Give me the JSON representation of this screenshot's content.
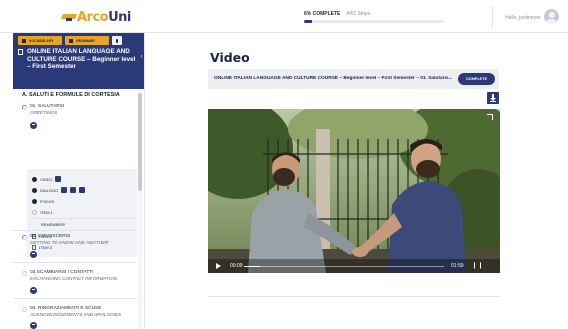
{
  "topbar": {
    "logo_a": "Arco",
    "logo_b": "Uni",
    "progress_text": "6% COMPLETE",
    "steps_text": "4/61 Steps",
    "progress_value": 0.06,
    "greeting": "Hello, jsolmecer"
  },
  "sidebar": {
    "vocabulary_label": "VOCABULARY",
    "grammar_label": "GRAMMAR",
    "course_title": "ONLINE ITALIAN LANGUAGE AND CULTURE COURSE – Beginner level – First Semester",
    "section_title": "A. SALUTI E FORMULE DI CORTESIA",
    "lessons": [
      {
        "title": "01. SALUTARSI",
        "subtitle": "GREETINGS"
      },
      {
        "title": "02. CONOSCERSI",
        "subtitle": "GETTING TO KNOW ONE ANOTHER"
      },
      {
        "title": "03.SCAMBIARSI I CONTATTI",
        "subtitle": "EXCHANGING CONTACT INFORMATION"
      },
      {
        "title": "04. RINGRAZIAMENTI E SCUSE",
        "subtitle": "ACKNOWLEDGEMENTS AND APOLOGIES"
      }
    ],
    "items": [
      {
        "label": "VIDEO"
      },
      {
        "label": "DIALOGO"
      },
      {
        "label": "FOCUS"
      },
      {
        "label": "ITEM 1"
      },
      {
        "label": "REMEMBER!"
      },
      {
        "label": "ITEM 2"
      },
      {
        "label": "ITEM 3"
      }
    ]
  },
  "main": {
    "title": "Video",
    "breadcrumb": "ONLINE ITALIAN LANGUAGE AND CULTURE COURSE – Beginner level – First Semester – 01. Salutarsi...",
    "complete_label": "COMPLETE",
    "video": {
      "current_time": "00:09",
      "total_time": "01:59",
      "played_fraction": 0.08
    }
  },
  "colors": {
    "navy": "#2a3a78",
    "accent": "#e8a423",
    "done": "#3cb27a"
  }
}
